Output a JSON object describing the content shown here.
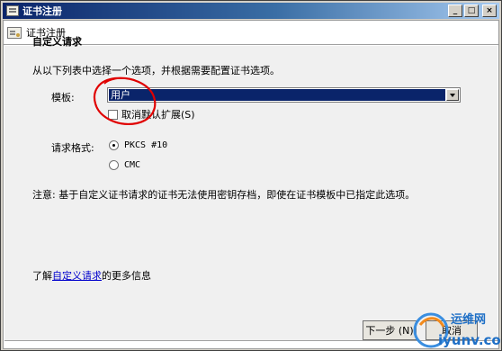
{
  "window": {
    "title": "证书注册",
    "minimize_label": "_",
    "maximize_label": "□",
    "close_label": "×"
  },
  "header": {
    "title": "证书注册"
  },
  "section": {
    "title": "自定义请求",
    "instruction": "从以下列表中选择一个选项，并根据需要配置证书选项。"
  },
  "template": {
    "label": "模板:",
    "selected": "用户"
  },
  "checkbox": {
    "label": "取消默认扩展(S)",
    "checked": false
  },
  "request_format": {
    "label": "请求格式:",
    "options": [
      "PKCS #10",
      "CMC"
    ],
    "selected": "PKCS #10"
  },
  "note": "注意: 基于自定义证书请求的证书无法使用密钥存档，即使在证书模板中已指定此选项。",
  "learn_more": {
    "prefix": "了解",
    "link": "自定义请求",
    "suffix": "的更多信息"
  },
  "buttons": {
    "next": "下一步 (N)",
    "cancel": "取消"
  },
  "watermark": {
    "line1": "运维网",
    "line2": "iyunv.com"
  },
  "colors": {
    "title_bar": "#0a246a",
    "selection": "#0a246a",
    "link": "#0000cc",
    "annotation": "#e00000"
  }
}
